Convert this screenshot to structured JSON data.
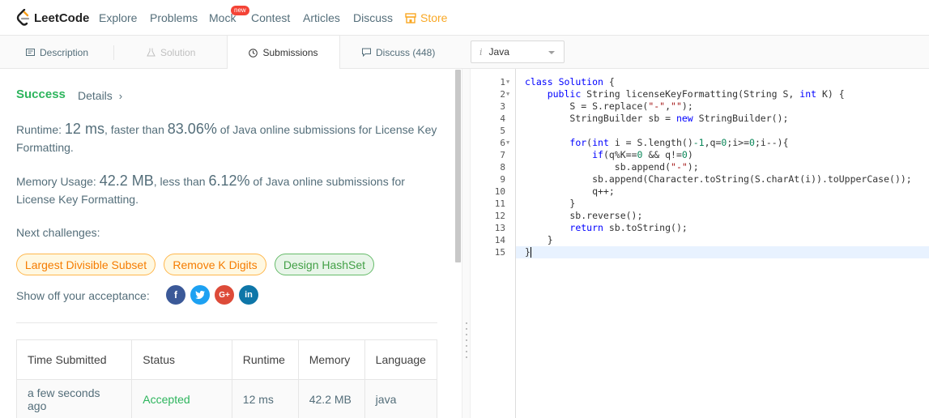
{
  "nav": {
    "logo_text": "LeetCode",
    "links": [
      "Explore",
      "Problems",
      "Mock",
      "Contest",
      "Articles",
      "Discuss"
    ],
    "mock_badge": "new",
    "store": "Store"
  },
  "tabs": {
    "description": "Description",
    "solution": "Solution",
    "submissions": "Submissions",
    "discuss": "Discuss (448)"
  },
  "language_select": {
    "value": "Java"
  },
  "result": {
    "status": "Success",
    "details": "Details",
    "runtime_label": "Runtime: ",
    "runtime_value": "12 ms",
    "runtime_mid": ", faster than ",
    "runtime_pct": "83.06%",
    "runtime_tail": " of Java online submissions for License Key Formatting.",
    "memory_label": "Memory Usage: ",
    "memory_value": "42.2 MB",
    "memory_mid": ", less than ",
    "memory_pct": "6.12%",
    "memory_tail": " of Java online submissions for License Key Formatting.",
    "next_label": "Next challenges:",
    "challenges": [
      "Largest Divisible Subset",
      "Remove K Digits",
      "Design HashSet"
    ],
    "showoff_label": "Show off your acceptance:"
  },
  "social": {
    "facebook": "f",
    "twitter": "t",
    "google": "G+",
    "linkedin": "in"
  },
  "submissions_table": {
    "headers": [
      "Time Submitted",
      "Status",
      "Runtime",
      "Memory",
      "Language"
    ],
    "rows": [
      [
        "a few seconds ago",
        "Accepted",
        "12 ms",
        "42.2 MB",
        "java"
      ]
    ]
  },
  "editor": {
    "line_numbers": [
      "1",
      "2",
      "3",
      "4",
      "5",
      "6",
      "7",
      "8",
      "9",
      "10",
      "11",
      "12",
      "13",
      "14",
      "15"
    ]
  },
  "colors": {
    "accent_green": "#2db55d",
    "medium_orange": "#f57c00",
    "store_yellow": "#f9a825",
    "badge_red": "#f44336"
  }
}
